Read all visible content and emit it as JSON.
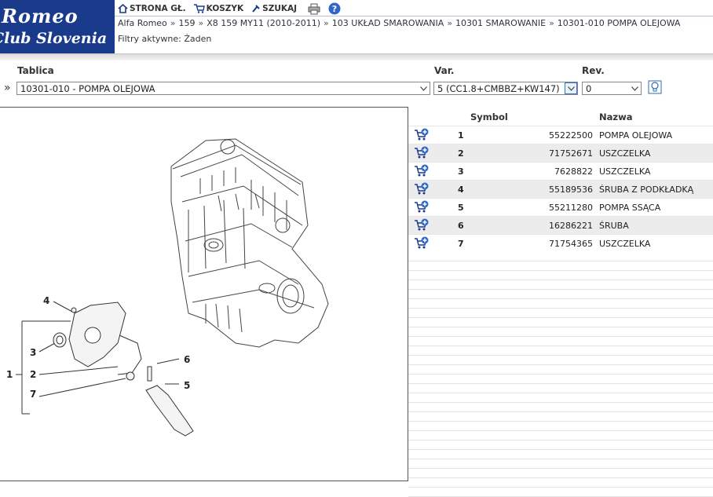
{
  "logo": {
    "line1": "Romeo",
    "line2": "Club Slovenia"
  },
  "nav": [
    {
      "label": "STRONA GŁ.",
      "icon": "home-icon"
    },
    {
      "label": "KOSZYK",
      "icon": "cart-icon"
    },
    {
      "label": "SZUKAJ",
      "icon": "search-icon"
    }
  ],
  "breadcrumb": [
    "Alfa Romeo",
    "159",
    "X8 159 MY11 (2010-2011)",
    "103 UKŁAD SMAROWANIA",
    "10301 SMAROWANIE",
    "10301-010 POMPA OLEJOWA"
  ],
  "breadcrumb_sep": "»",
  "filters": "Filtry aktywne: Żaden",
  "labels": {
    "tablica": "Tablica",
    "var": "Var.",
    "rev": "Rev."
  },
  "selects": {
    "tablica": "10301-010 - POMPA OLEJOWA",
    "var": "5 (CC1.8+CMBBZ+KW147)",
    "rev": "0"
  },
  "table": {
    "headers": {
      "symbol": "Symbol",
      "nazwa": "Nazwa"
    },
    "rows": [
      {
        "pos": "1",
        "symbol": "55222500",
        "name": "POMPA OLEJOWA"
      },
      {
        "pos": "2",
        "symbol": "71752671",
        "name": "USZCZELKA"
      },
      {
        "pos": "3",
        "symbol": "7628822",
        "name": "USZCZELKA"
      },
      {
        "pos": "4",
        "symbol": "55189536",
        "name": "ŚRUBA Z PODKŁADKĄ"
      },
      {
        "pos": "5",
        "symbol": "55211280",
        "name": "POMPA SSĄCA"
      },
      {
        "pos": "6",
        "symbol": "16286221",
        "name": "ŚRUBA"
      },
      {
        "pos": "7",
        "symbol": "71754365",
        "name": "USZCZELKA"
      }
    ]
  },
  "diagram_callouts": [
    "1",
    "2",
    "3",
    "4",
    "5",
    "6",
    "7"
  ]
}
